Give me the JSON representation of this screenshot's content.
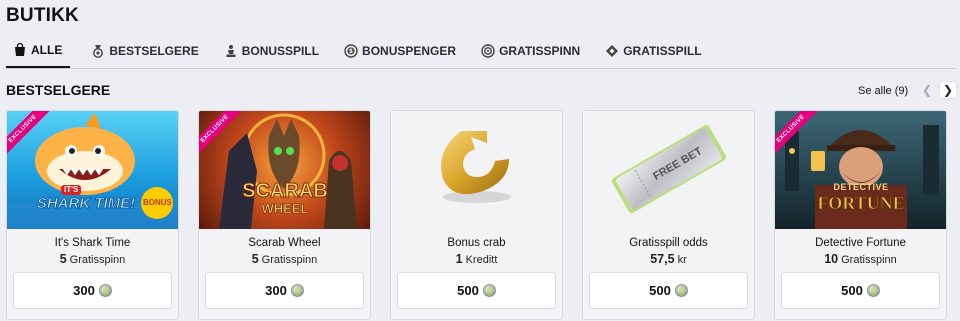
{
  "page": {
    "title": "BUTIKK"
  },
  "tabs": [
    {
      "label": "ALLE",
      "icon": "shopping-bag-icon",
      "active": true
    },
    {
      "label": "BESTSELGERE",
      "icon": "medal-icon",
      "active": false
    },
    {
      "label": "BONUSSPILL",
      "icon": "chess-piece-icon",
      "active": false
    },
    {
      "label": "BONUSPENGER",
      "icon": "coin-icon",
      "active": false
    },
    {
      "label": "GRATISSPINN",
      "icon": "spin-icon",
      "active": false
    },
    {
      "label": "GRATISSPILL",
      "icon": "ticket-diamond-icon",
      "active": false
    }
  ],
  "section": {
    "title": "BESTSELGERE",
    "see_all": "Se alle (9)",
    "prev_icon": "chevron-left-icon",
    "next_icon": "chevron-right-icon"
  },
  "cards": [
    {
      "name": "It's Shark Time",
      "qty_value": "5",
      "qty_unit": "Gratisspinn",
      "price": "300",
      "badge": "EXCLUSIVE",
      "art_line1": "IT'S",
      "art_line2": "SHARK TIME!",
      "art_extra": "BONUS",
      "colors": {
        "bg": "#28b3e8",
        "accent": "#ffb300"
      }
    },
    {
      "name": "Scarab Wheel",
      "qty_value": "5",
      "qty_unit": "Gratisspinn",
      "price": "300",
      "badge": "EXCLUSIVE",
      "art_line1": "SCARAB",
      "art_line2": "WHEEL",
      "colors": {
        "bg": "#a2431a",
        "accent": "#ffcc33"
      }
    },
    {
      "name": "Bonus crab",
      "qty_value": "1",
      "qty_unit": "Kreditt",
      "price": "500",
      "colors": {
        "bg": "#f3f3f5",
        "accent": "#d9a52a"
      }
    },
    {
      "name": "Gratisspill odds",
      "qty_value": "57,5",
      "qty_unit": "kr",
      "price": "500",
      "art_line1": "FREE BET",
      "colors": {
        "bg": "#f3f3f5",
        "accent": "#b8e07c"
      }
    },
    {
      "name": "Detective Fortune",
      "qty_value": "10",
      "qty_unit": "Gratisspinn",
      "price": "500",
      "badge": "EXCLUSIVE",
      "art_line1": "DETECTIVE",
      "art_line2": "FORTUNE",
      "colors": {
        "bg": "#2c4a57",
        "accent": "#f2c14e"
      }
    }
  ]
}
